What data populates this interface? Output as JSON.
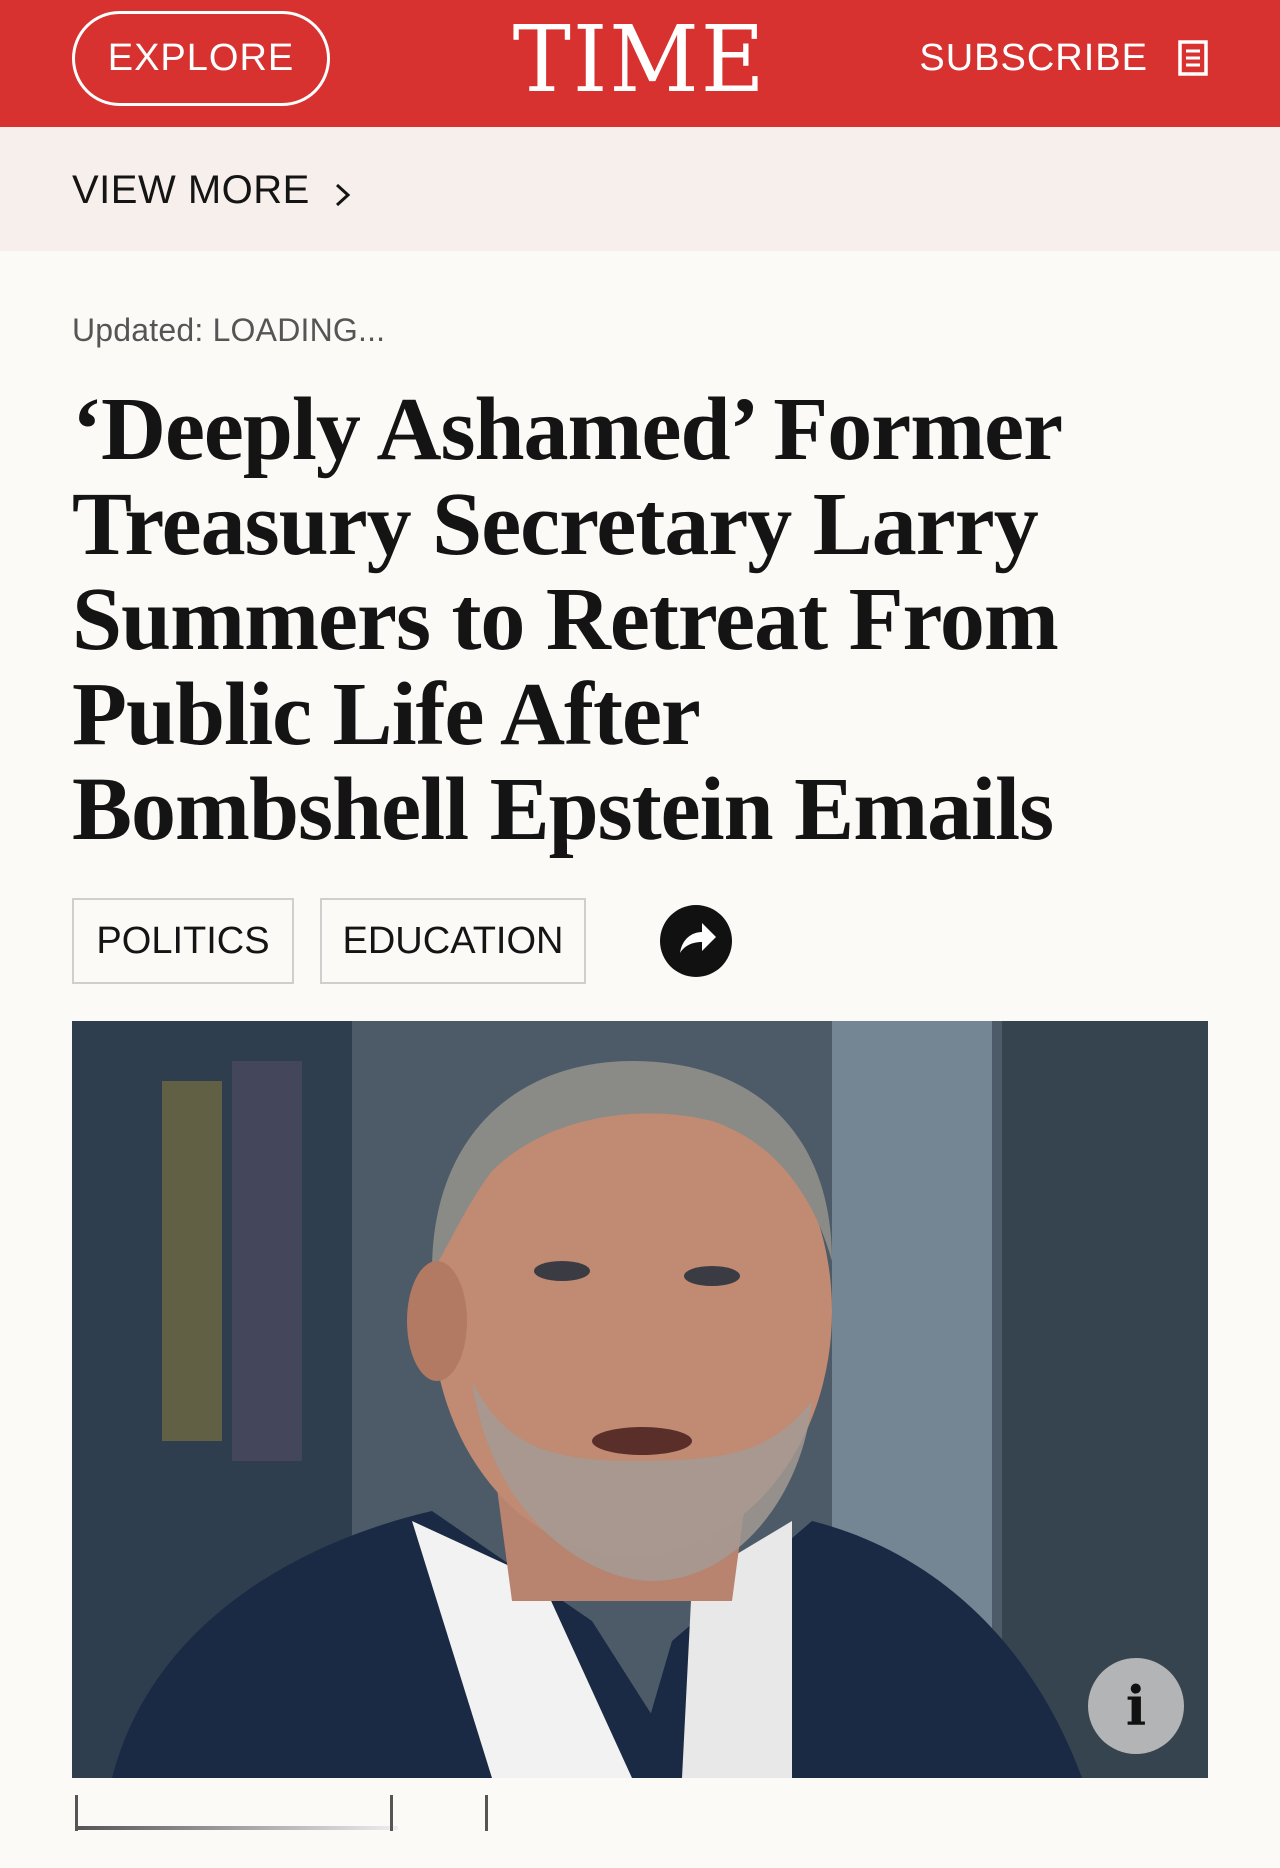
{
  "header": {
    "explore_label": "EXPLORE",
    "logo_text": "TIME",
    "subscribe_label": "SUBSCRIBE",
    "brand_color": "#d7322f"
  },
  "nav": {
    "view_more_label": "VIEW MORE"
  },
  "article": {
    "updated_text": "Updated: LOADING...",
    "headline": "‘Deeply Ashamed’ Former Treasury Secretary Larry Summers to Retreat From Public Life After Bombshell Epstein Emails",
    "tags": [
      "POLITICS",
      "EDUCATION"
    ],
    "photo_info_glyph": "i"
  },
  "icons": {
    "magazine": "magazine-icon",
    "chevron": "chevron-right-icon",
    "share": "share-icon",
    "info": "info-icon"
  }
}
